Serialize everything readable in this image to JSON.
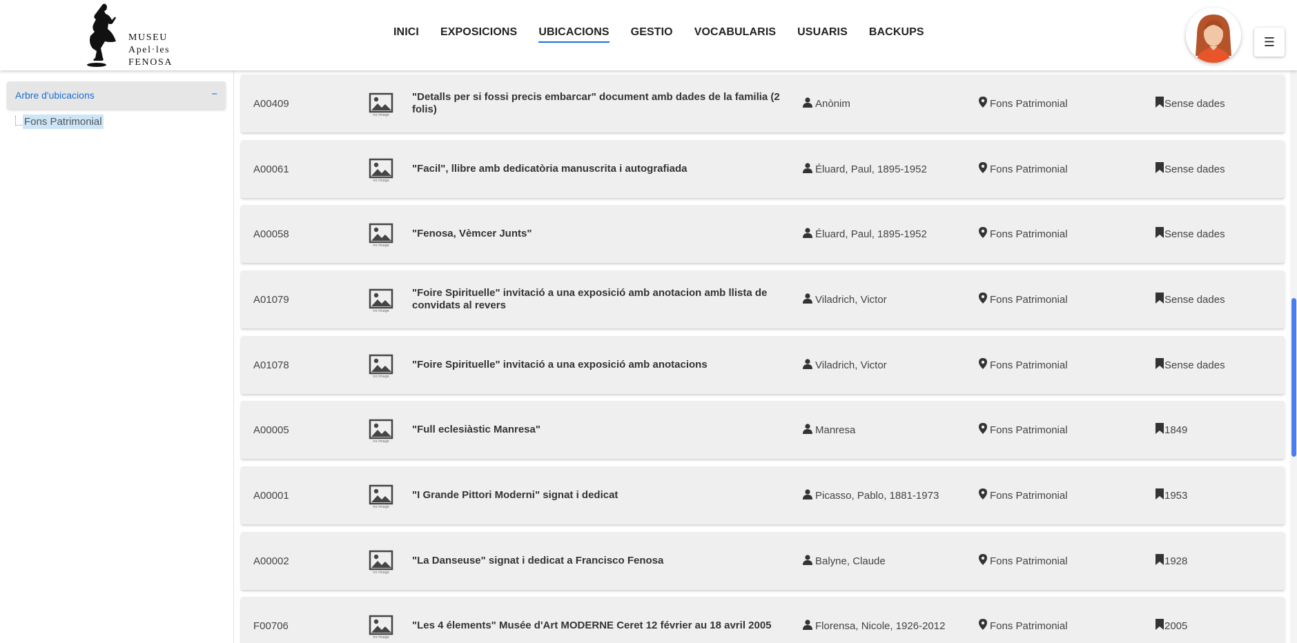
{
  "logo": {
    "lines": [
      "MUSEU",
      "Apel·les",
      "FENOSA"
    ]
  },
  "nav": {
    "items": [
      "INICI",
      "EXPOSICIONS",
      "UBICACIONS",
      "GESTIO",
      "VOCABULARIS",
      "USUARIS",
      "BACKUPS"
    ],
    "active": "UBICACIONS"
  },
  "menu_icon": "hamburger-icon",
  "sidebar": {
    "tree_title": "Arbre d'ubicacions",
    "tree_toggle": "−",
    "node": "Fons Patrimonial"
  },
  "rows": [
    {
      "id": "A00409",
      "title": "\"Detalls per si fossi precis embarcar\" document amb dades de la familia (2 folis)",
      "author": "Anònim",
      "location": "Fons Patrimonial",
      "date": "Sense dades"
    },
    {
      "id": "A00061",
      "title": "\"Facil\", llibre amb dedicatòria manuscrita i autografiada",
      "author": "Éluard, Paul, 1895-1952",
      "location": "Fons Patrimonial",
      "date": "Sense dades"
    },
    {
      "id": "A00058",
      "title": "\"Fenosa, Vèmcer Junts\"",
      "author": "Éluard, Paul, 1895-1952",
      "location": "Fons Patrimonial",
      "date": "Sense dades"
    },
    {
      "id": "A01079",
      "title": "\"Foire Spirituelle\" invitació a una exposició amb anotacion amb llista de convidats al revers",
      "author": "Viladrich, Victor",
      "location": "Fons Patrimonial",
      "date": "Sense dades"
    },
    {
      "id": "A01078",
      "title": "\"Foire Spirituelle\" invitació a una exposició amb anotacions",
      "author": "Viladrich, Victor",
      "location": "Fons Patrimonial",
      "date": "Sense dades"
    },
    {
      "id": "A00005",
      "title": "\"Full eclesiàstic Manresa\"",
      "author": "Manresa",
      "location": "Fons Patrimonial",
      "date": "1849"
    },
    {
      "id": "A00001",
      "title": "\"I Grande Pittori Moderni\" signat i dedicat",
      "author": "Picasso, Pablo, 1881-1973",
      "location": "Fons Patrimonial",
      "date": "1953"
    },
    {
      "id": "A00002",
      "title": "\"La Danseuse\" signat i dedicat a Francisco Fenosa",
      "author": "Balyne, Claude",
      "location": "Fons Patrimonial",
      "date": "1928"
    },
    {
      "id": "F00706",
      "title": "\"Les 4 élements\" Musée d'Art MODERNE Ceret 12 février au 18 avril 2005",
      "author": "Florensa, Nicole, 1926-2012",
      "location": "Fons Patrimonial",
      "date": "2005"
    }
  ],
  "icons": {
    "thumbnail": "image-placeholder-icon",
    "author": "person-icon",
    "location": "map-pin-icon",
    "date": "bookmark-icon"
  },
  "colors": {
    "accent": "#1a6fd6",
    "row_bg": "#efefef",
    "selected_node": "#cce6f7",
    "scrollbar": "#4a7df0"
  }
}
